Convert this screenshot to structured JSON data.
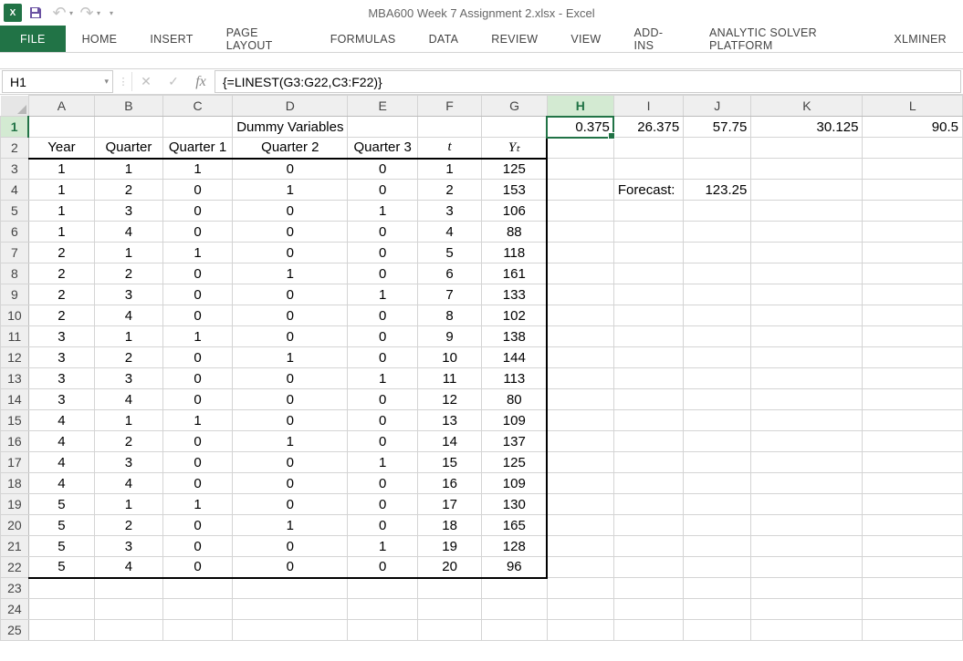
{
  "title": "MBA600 Week 7 Assignment 2.xlsx - Excel",
  "name_box": "H1",
  "formula": "{=LINEST(G3:G22,C3:F22)}",
  "ribbon": {
    "file": "FILE",
    "tabs": [
      "HOME",
      "INSERT",
      "PAGE LAYOUT",
      "FORMULAS",
      "DATA",
      "REVIEW",
      "VIEW",
      "ADD-INS",
      "ANALYTIC SOLVER PLATFORM",
      "XLMINER"
    ]
  },
  "columns": [
    "A",
    "B",
    "C",
    "D",
    "E",
    "F",
    "G",
    "H",
    "I",
    "J",
    "K",
    "L"
  ],
  "selected_cell": {
    "col": "H",
    "row": 1
  },
  "row1": {
    "dummy_label": "Dummy Variables",
    "linest": [
      "0.375",
      "26.375",
      "57.75",
      "30.125",
      "90.5"
    ]
  },
  "row2_headers": {
    "year": "Year",
    "quarter": "Quarter",
    "q1": "Quarter 1",
    "q2": "Quarter 2",
    "q3": "Quarter 3",
    "t": "t",
    "yt": "Yₜ"
  },
  "forecast_label": "Forecast:",
  "forecast_value": "123.25",
  "data_rows": [
    {
      "year": "1",
      "quarter": "1",
      "q1": "1",
      "q2": "0",
      "q3": "0",
      "t": "1",
      "yt": "125"
    },
    {
      "year": "1",
      "quarter": "2",
      "q1": "0",
      "q2": "1",
      "q3": "0",
      "t": "2",
      "yt": "153"
    },
    {
      "year": "1",
      "quarter": "3",
      "q1": "0",
      "q2": "0",
      "q3": "1",
      "t": "3",
      "yt": "106"
    },
    {
      "year": "1",
      "quarter": "4",
      "q1": "0",
      "q2": "0",
      "q3": "0",
      "t": "4",
      "yt": "88"
    },
    {
      "year": "2",
      "quarter": "1",
      "q1": "1",
      "q2": "0",
      "q3": "0",
      "t": "5",
      "yt": "118"
    },
    {
      "year": "2",
      "quarter": "2",
      "q1": "0",
      "q2": "1",
      "q3": "0",
      "t": "6",
      "yt": "161"
    },
    {
      "year": "2",
      "quarter": "3",
      "q1": "0",
      "q2": "0",
      "q3": "1",
      "t": "7",
      "yt": "133"
    },
    {
      "year": "2",
      "quarter": "4",
      "q1": "0",
      "q2": "0",
      "q3": "0",
      "t": "8",
      "yt": "102"
    },
    {
      "year": "3",
      "quarter": "1",
      "q1": "1",
      "q2": "0",
      "q3": "0",
      "t": "9",
      "yt": "138"
    },
    {
      "year": "3",
      "quarter": "2",
      "q1": "0",
      "q2": "1",
      "q3": "0",
      "t": "10",
      "yt": "144"
    },
    {
      "year": "3",
      "quarter": "3",
      "q1": "0",
      "q2": "0",
      "q3": "1",
      "t": "11",
      "yt": "113"
    },
    {
      "year": "3",
      "quarter": "4",
      "q1": "0",
      "q2": "0",
      "q3": "0",
      "t": "12",
      "yt": "80"
    },
    {
      "year": "4",
      "quarter": "1",
      "q1": "1",
      "q2": "0",
      "q3": "0",
      "t": "13",
      "yt": "109"
    },
    {
      "year": "4",
      "quarter": "2",
      "q1": "0",
      "q2": "1",
      "q3": "0",
      "t": "14",
      "yt": "137"
    },
    {
      "year": "4",
      "quarter": "3",
      "q1": "0",
      "q2": "0",
      "q3": "1",
      "t": "15",
      "yt": "125"
    },
    {
      "year": "4",
      "quarter": "4",
      "q1": "0",
      "q2": "0",
      "q3": "0",
      "t": "16",
      "yt": "109"
    },
    {
      "year": "5",
      "quarter": "1",
      "q1": "1",
      "q2": "0",
      "q3": "0",
      "t": "17",
      "yt": "130"
    },
    {
      "year": "5",
      "quarter": "2",
      "q1": "0",
      "q2": "1",
      "q3": "0",
      "t": "18",
      "yt": "165"
    },
    {
      "year": "5",
      "quarter": "3",
      "q1": "0",
      "q2": "0",
      "q3": "1",
      "t": "19",
      "yt": "128"
    },
    {
      "year": "5",
      "quarter": "4",
      "q1": "0",
      "q2": "0",
      "q3": "0",
      "t": "20",
      "yt": "96"
    }
  ],
  "total_visible_rows": 25
}
